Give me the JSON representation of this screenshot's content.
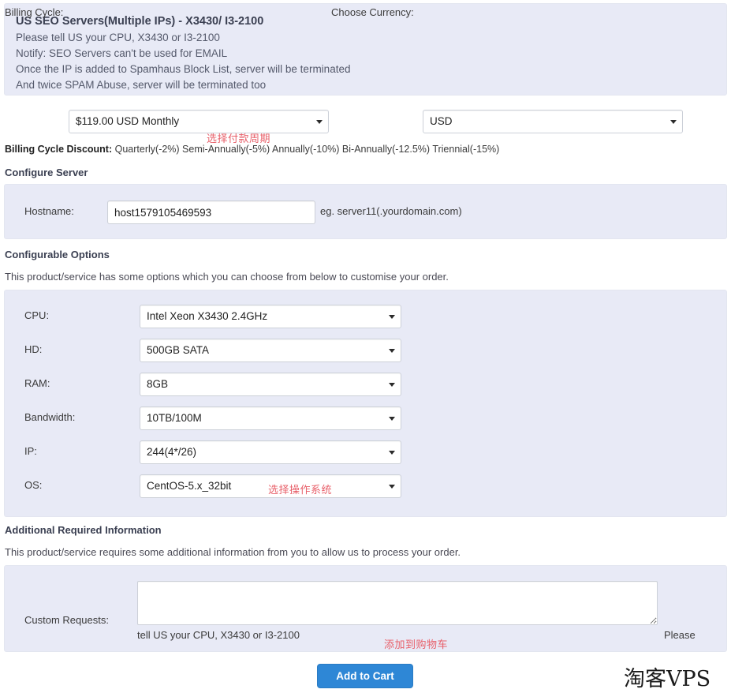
{
  "product": {
    "title": "US SEO Servers(Multiple IPs) - X3430/ I3-2100",
    "description_lines": [
      "Please tell US your CPU, X3430 or I3-2100",
      "Notify: SEO Servers can't be used for EMAIL",
      "Once the IP is added to Spamhaus Block List, server will be terminated",
      "And twice SPAM Abuse, server will be terminated too"
    ]
  },
  "billing": {
    "cycle_label": "Billing Cycle:",
    "cycle_value": "$119.00 USD Monthly",
    "currency_label": "Choose Currency:",
    "currency_value": "USD",
    "discount_label": "Billing Cycle Discount:",
    "discount_value": "Quarterly(-2%) Semi-Annually(-5%) Annually(-10%) Bi-Annually(-12.5%) Triennial(-15%)"
  },
  "configure_server": {
    "heading": "Configure Server",
    "hostname_label": "Hostname:",
    "hostname_value": "host1579105469593",
    "hostname_hint": "eg. server11(.yourdomain.com)"
  },
  "configurable_options": {
    "heading": "Configurable Options",
    "subtitle": "This product/service has some options which you can choose from below to customise your order.",
    "rows": [
      {
        "label": "CPU:",
        "value": "Intel Xeon X3430 2.4GHz"
      },
      {
        "label": "HD:",
        "value": "500GB SATA"
      },
      {
        "label": "RAM:",
        "value": "8GB"
      },
      {
        "label": "Bandwidth:",
        "value": "10TB/100M"
      },
      {
        "label": "IP:",
        "value": "244(4*/26)"
      },
      {
        "label": "OS:",
        "value": "CentOS-5.x_32bit"
      }
    ]
  },
  "additional_information": {
    "heading": "Additional Required Information",
    "subtitle": "This product/service requires some additional information from you to allow us to process your order.",
    "custom_requests_label": "Custom Requests:",
    "custom_requests_value": "",
    "hint_part_a": "Please",
    "hint_part_b": "tell US your CPU, X3430 or I3-2100"
  },
  "actions": {
    "add_to_cart_label": "Add to Cart"
  },
  "annotations": {
    "billing_cycle": "选择付款周期",
    "operating_system": "选择操作系统",
    "add_to_cart": "添加到购物车"
  },
  "watermark": {
    "text": "淘客VPS"
  },
  "colors": {
    "panel_background": "#e8eaf6",
    "primary_button": "#2e87d6",
    "annotation_red": "#e8606a",
    "heading_text": "#3a3f51"
  }
}
